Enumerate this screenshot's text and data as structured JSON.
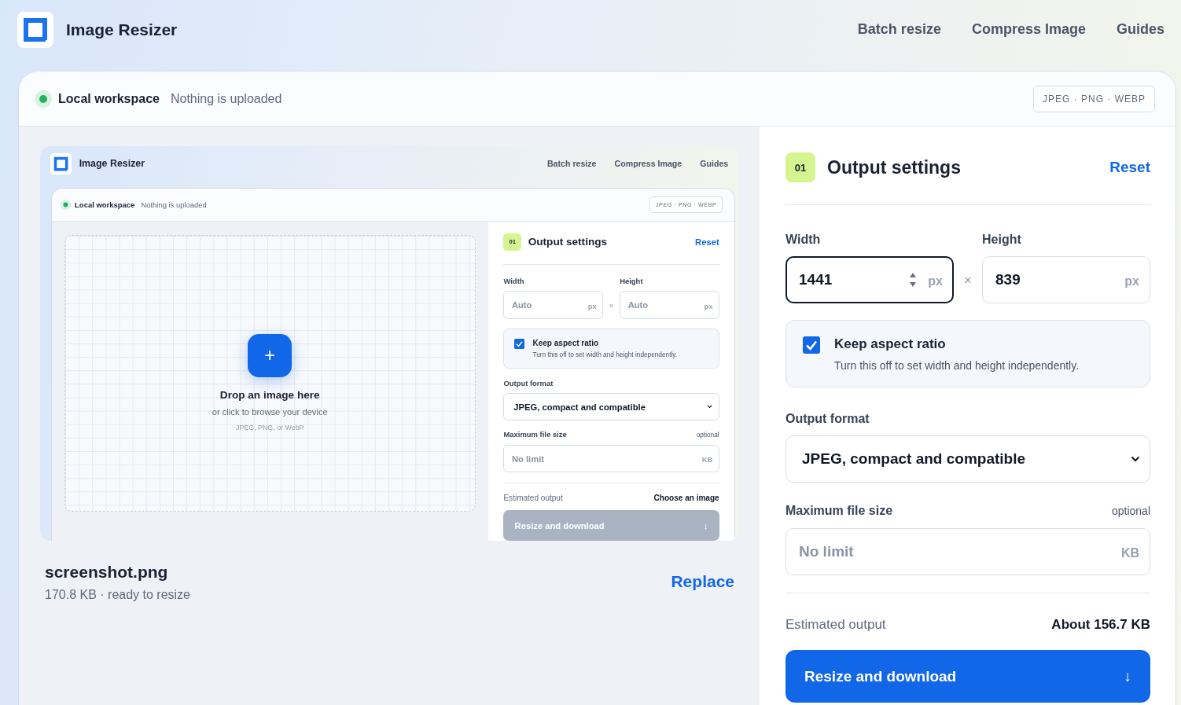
{
  "header": {
    "title": "Image Resizer",
    "nav": [
      {
        "label": "Batch resize"
      },
      {
        "label": "Compress Image"
      },
      {
        "label": "Guides"
      }
    ]
  },
  "workspace": {
    "name": "Local workspace",
    "status": "Nothing is uploaded",
    "formats": "JPEG · PNG · WEBP"
  },
  "main": {
    "kind": "file",
    "preview": {
      "kind": "screenshot",
      "app": {
        "header": {
          "title": "Image Resizer",
          "nav": [
            {
              "label": "Batch resize"
            },
            {
              "label": "Compress Image"
            },
            {
              "label": "Guides"
            }
          ]
        },
        "workspace": {
          "name": "Local workspace",
          "status": "Nothing is uploaded",
          "formats": "JPEG · PNG · WEBP"
        },
        "main": {
          "kind": "dropzone",
          "add": "+",
          "title": "Drop an image here",
          "subtitle": "or click to browse your device",
          "hint": "JPEG, PNG, or WebP"
        },
        "settings": {
          "step": "01",
          "title": "Output settings",
          "reset": "Reset",
          "width": {
            "label": "Width",
            "placeholder": "Auto",
            "unit": "px",
            "focused": false
          },
          "times": "×",
          "height": {
            "label": "Height",
            "placeholder": "Auto",
            "unit": "px",
            "focused": false
          },
          "aspect": {
            "label": "Keep aspect ratio",
            "hint": "Turn this off to set width and height independently.",
            "checked": true
          },
          "format": {
            "label": "Output format",
            "value": "JPEG, compact and compatible"
          },
          "max_size": {
            "label": "Maximum file size",
            "note": "optional",
            "placeholder": "No limit",
            "unit": "KB"
          },
          "estimate": {
            "label": "Estimated output",
            "value": "Choose an image"
          },
          "action": {
            "label": "Resize and download",
            "icon": "↓",
            "disabled": true
          }
        }
      }
    },
    "file_name": "screenshot.png",
    "file_meta": "170.8 KB · ready to resize",
    "replace": "Replace"
  },
  "settings": {
    "step": "01",
    "title": "Output settings",
    "reset": "Reset",
    "width": {
      "label": "Width",
      "value": "1441",
      "unit": "px",
      "focused": true
    },
    "times": "×",
    "height": {
      "label": "Height",
      "value": "839",
      "unit": "px",
      "focused": false
    },
    "aspect": {
      "label": "Keep aspect ratio",
      "hint": "Turn this off to set width and height independently.",
      "checked": true
    },
    "format": {
      "label": "Output format",
      "value": "JPEG, compact and compatible"
    },
    "max_size": {
      "label": "Maximum file size",
      "note": "optional",
      "placeholder": "No limit",
      "unit": "KB"
    },
    "estimate": {
      "label": "Estimated output",
      "value": "About 156.7 KB"
    },
    "action": {
      "label": "Resize and download",
      "icon": "↓",
      "disabled": false
    }
  }
}
